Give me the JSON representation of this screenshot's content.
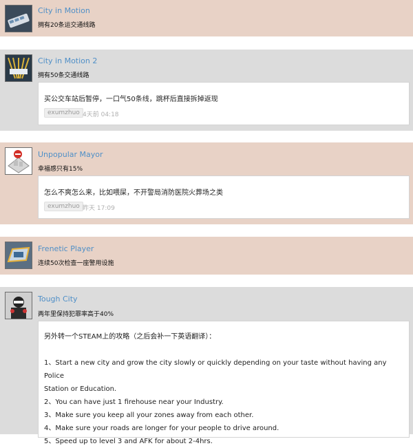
{
  "achievements": [
    {
      "title": "City in Motion",
      "desc": "拥有20条运交通线路",
      "icon": "bus-icon"
    },
    {
      "title": "City in Motion 2",
      "desc": "拥有50条交通线路",
      "icon": "transit-lines-icon",
      "comment": {
        "text": "买公交车站后暂停，一口气50条线，跳杯后直接拆掉返现",
        "user": "exumzhuo",
        "time": "4天前 04:18"
      }
    },
    {
      "title": "Unpopular Mayor",
      "desc": "幸福感只有15%",
      "icon": "unhappy-city-icon",
      "comment": {
        "text": "怎么不爽怎么来，比如喂屎，不开警局消防医院火葬场之类",
        "user": "exumzhuo",
        "time": "昨天 17:09"
      }
    },
    {
      "title": "Frenetic Player",
      "desc": "连续50次检查一座警用设施",
      "icon": "police-badge-icon"
    },
    {
      "title": "Tough City",
      "desc": "两年里保持犯罪率高于40%",
      "icon": "criminal-icon",
      "guide": [
        "另外转一个STEAM上的攻略（之后会补一下英语翻译）：",
        "",
        "1、Start a new city and grow the city slowly or quickly depending on your taste without having any Police",
        "Station or Education.",
        "2、You can have just 1 firehouse near your Industry.",
        "3、Make sure you keep all your zones away from each other.",
        "4、Make sure your roads are longer for your people to drive around.",
        "5、Speed up to level 3 and AFK for about 2-4hrs."
      ]
    }
  ]
}
